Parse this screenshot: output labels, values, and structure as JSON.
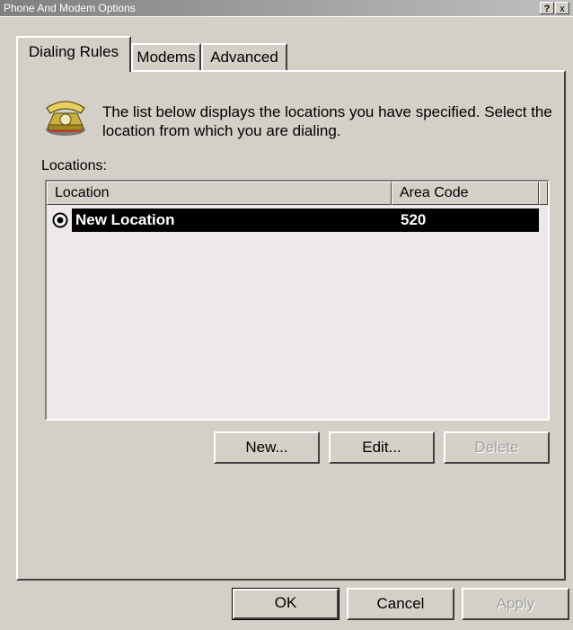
{
  "window": {
    "title": "Phone And Modem Options",
    "help_glyph": "?",
    "close_glyph": "x"
  },
  "tabs": [
    {
      "label": "Dialing Rules",
      "active": true
    },
    {
      "label": "Modems",
      "active": false
    },
    {
      "label": "Advanced",
      "active": false
    }
  ],
  "dialing_rules": {
    "description": "The list below displays the locations you have specified. Select the location from which you are dialing.",
    "locations_label": "Locations:",
    "columns": [
      "Location",
      "Area Code"
    ],
    "rows": [
      {
        "location": "New Location",
        "area_code": "520",
        "selected": true
      }
    ],
    "buttons": {
      "new": "New...",
      "edit": "Edit...",
      "delete": "Delete"
    }
  },
  "footer": {
    "ok": "OK",
    "cancel": "Cancel",
    "apply": "Apply"
  },
  "icons": {
    "phone": "phone-icon",
    "radio": "radio-selected-icon"
  },
  "colors": {
    "face": "#d4d0c8",
    "selection": "#000000",
    "list_bg": "#eee8e8"
  }
}
